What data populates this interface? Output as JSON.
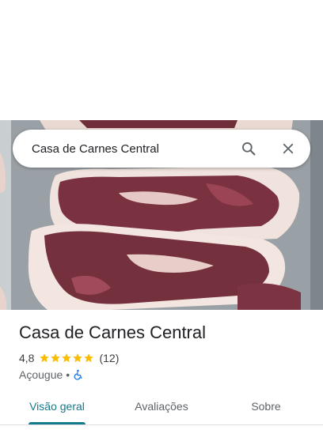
{
  "search": {
    "value": "Casa de Carnes Central",
    "search_icon": "search-icon",
    "close_icon": "close-icon"
  },
  "hero": {
    "image_subject": "cuts of raw beef steak on a metal tray"
  },
  "place": {
    "name": "Casa de Carnes Central",
    "rating": "4,8",
    "stars": 5,
    "star_color": "#fbbc04",
    "review_count": "(12)",
    "category": "Açougue",
    "separator": "•",
    "accessibility_icon": "wheelchair-icon",
    "accessibility_color": "#1a73e8"
  },
  "tabs": [
    {
      "label": "Visão geral",
      "active": true
    },
    {
      "label": "Avaliações",
      "active": false
    },
    {
      "label": "Sobre",
      "active": false
    }
  ],
  "colors": {
    "active_tab": "#137a8a"
  }
}
